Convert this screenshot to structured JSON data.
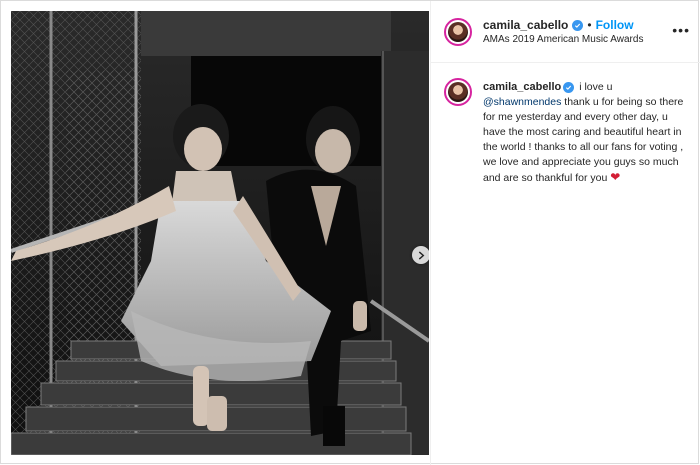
{
  "post": {
    "account": {
      "username": "camila_cabello",
      "verified": true
    },
    "header": {
      "separator": "•",
      "follow_label": "Follow",
      "location": "AMAs 2019 American Music Awards",
      "more_label": "•••"
    },
    "caption": {
      "username": "camila_cabello",
      "text_before_mention": "i love u",
      "mention": "@shawnmendes",
      "text_after_mention": "thank u for being so there for me yesterday and every other day, u have the most caring and beautiful heart in the world ! thanks to all our fans for voting , we love and appreciate you guys so much and are so thankful for you",
      "emoji": "❤"
    },
    "photo": {
      "style": "black-and-white",
      "carousel_next_icon": "chevron-right-icon"
    }
  },
  "colors": {
    "link_blue": "#0095f6",
    "verified_blue": "#3897f0",
    "mention": "#00376b",
    "heart": "#d31e35",
    "story_ring": "#d6249f"
  }
}
